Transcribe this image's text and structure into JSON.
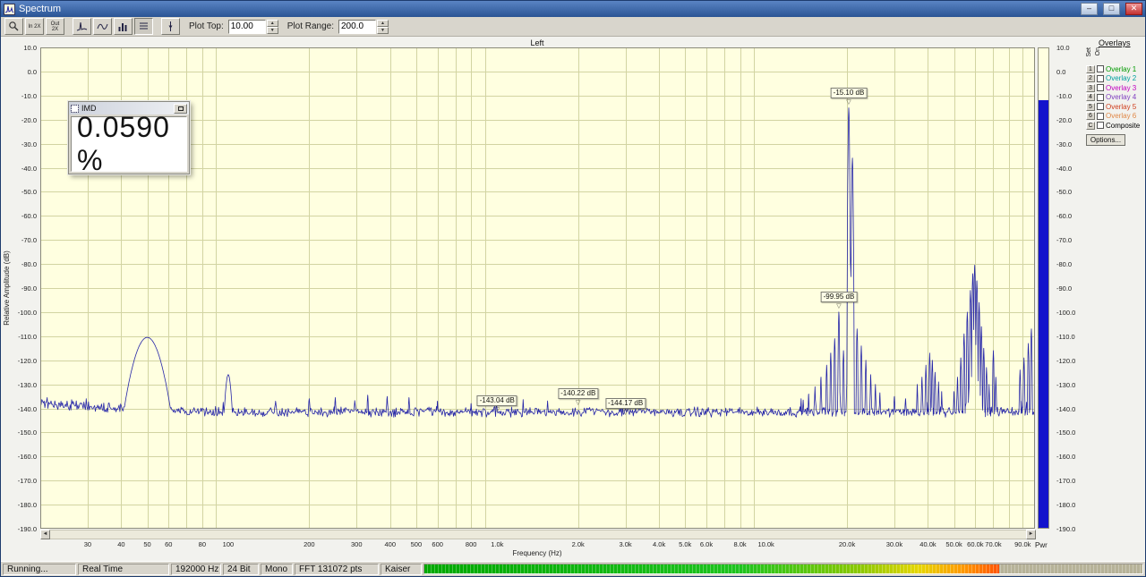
{
  "window": {
    "title": "Spectrum",
    "controls": {
      "minimize_glyph": "–",
      "maximize_glyph": "□",
      "close_glyph": "✕"
    }
  },
  "toolbar": {
    "zoom_in_2x": "In 2X",
    "zoom_out_2x": "Out 2X",
    "plot_top_label": "Plot Top:",
    "plot_top_value": "10.00",
    "plot_range_label": "Plot Range:",
    "plot_range_value": "200.0",
    "spin_up_glyph": "▲",
    "spin_down_glyph": "▼"
  },
  "plot": {
    "channel_label": "Left",
    "y_axis_title": "Relative Amplitude (dB)",
    "x_axis_title": "Frequency (Hz)"
  },
  "scrollbar": {
    "left_glyph": "◄",
    "right_glyph": "►"
  },
  "meter": {
    "value_db": -12.2,
    "label": "Pwr"
  },
  "imd": {
    "title": "IMD",
    "value": "0.0590 %"
  },
  "overlays": {
    "title": "Overlays",
    "col_set": "Set",
    "col_on": "On",
    "items": [
      {
        "num": "1",
        "label": "Overlay 1",
        "color": "#009900",
        "checked": false
      },
      {
        "num": "2",
        "label": "Overlay 2",
        "color": "#00a0a0",
        "checked": false
      },
      {
        "num": "3",
        "label": "Overlay 3",
        "color": "#c000c0",
        "checked": false
      },
      {
        "num": "4",
        "label": "Overlay 4",
        "color": "#8040c0",
        "checked": false
      },
      {
        "num": "5",
        "label": "Overlay 5",
        "color": "#d04020",
        "checked": false
      },
      {
        "num": "6",
        "label": "Overlay 6",
        "color": "#e08848",
        "checked": false
      },
      {
        "num": "C",
        "label": "Composite",
        "color": "#000000",
        "checked": false
      }
    ],
    "options_label": "Options..."
  },
  "status_bar": {
    "segments": [
      "Running...",
      "Real Time",
      "192000 Hz",
      "24 Bit",
      "Mono",
      "FFT 131072 pts",
      "Kaiser"
    ],
    "progress_fraction": 0.8
  },
  "chart_data": {
    "type": "line",
    "title": "Real-time FFT spectrum, Left channel, IMD test",
    "xlabel": "Frequency (Hz)",
    "ylabel": "Relative Amplitude (dB)",
    "x_scale": "log",
    "x_range_hz": [
      20,
      100000
    ],
    "y_range_db": [
      -190,
      10
    ],
    "grid": true,
    "plot_bg": "#ffffe0",
    "grid_color": "#d2d4a2",
    "trace_color": "#2626a8",
    "noise_floor_db": -141.5,
    "y_ticks": [
      "10.0",
      "0.0",
      "-10.0",
      "-20.0",
      "-30.0",
      "-40.0",
      "-50.0",
      "-60.0",
      "-70.0",
      "-80.0",
      "-90.0",
      "-100.0",
      "-110.0",
      "-120.0",
      "-130.0",
      "-140.0",
      "-150.0",
      "-160.0",
      "-170.0",
      "-180.0",
      "-190.0"
    ],
    "x_ticks": [
      {
        "f": 30,
        "t": "30"
      },
      {
        "f": 40,
        "t": "40"
      },
      {
        "f": 50,
        "t": "50"
      },
      {
        "f": 60,
        "t": "60"
      },
      {
        "f": 80,
        "t": "80"
      },
      {
        "f": 100,
        "t": "100"
      },
      {
        "f": 200,
        "t": "200"
      },
      {
        "f": 300,
        "t": "300"
      },
      {
        "f": 400,
        "t": "400"
      },
      {
        "f": 500,
        "t": "500"
      },
      {
        "f": 600,
        "t": "600"
      },
      {
        "f": 800,
        "t": "800"
      },
      {
        "f": 1000,
        "t": "1.0k"
      },
      {
        "f": 2000,
        "t": "2.0k"
      },
      {
        "f": 3000,
        "t": "3.0k"
      },
      {
        "f": 4000,
        "t": "4.0k"
      },
      {
        "f": 5000,
        "t": "5.0k"
      },
      {
        "f": 6000,
        "t": "6.0k"
      },
      {
        "f": 8000,
        "t": "8.0k"
      },
      {
        "f": 10000,
        "t": "10.0k"
      },
      {
        "f": 20000,
        "t": "20.0k"
      },
      {
        "f": 30000,
        "t": "30.0k"
      },
      {
        "f": 40000,
        "t": "40.0k"
      },
      {
        "f": 50000,
        "t": "50.0k"
      },
      {
        "f": 60000,
        "t": "60.0k"
      },
      {
        "f": 70000,
        "t": "70.0k"
      },
      {
        "f": 90000,
        "t": "90.0k"
      }
    ],
    "markers": [
      {
        "text": "-15.10 dB",
        "f": 20300,
        "db": -15.1
      },
      {
        "text": "-99.95 dB",
        "f": 18650,
        "db": -99.95
      },
      {
        "text": "-143.04 dB",
        "f": 1000,
        "db": -143.04
      },
      {
        "text": "-140.22 dB",
        "f": 2000,
        "db": -140.22
      },
      {
        "text": "-144.17 dB",
        "f": 3000,
        "db": -144.17
      }
    ],
    "peaks": [
      {
        "f": 50,
        "db": -110.5,
        "s": 0.05
      },
      {
        "f": 100,
        "db": -126,
        "s": 0.012
      },
      {
        "f": 150,
        "db": -137,
        "s": 0.004
      },
      {
        "f": 200,
        "db": -136,
        "s": 0.004
      },
      {
        "f": 250,
        "db": -135.5,
        "s": 0.003
      },
      {
        "f": 330,
        "db": -134.5,
        "s": 0.003
      },
      {
        "f": 390,
        "db": -135,
        "s": 0.003
      },
      {
        "f": 470,
        "db": -135.5,
        "s": 0.003
      },
      {
        "f": 600,
        "db": -137,
        "s": 0.003
      },
      {
        "f": 800,
        "db": -138,
        "s": 0.003
      },
      {
        "f": 13500,
        "db": -136
      },
      {
        "f": 14400,
        "db": -134
      },
      {
        "f": 15200,
        "db": -131
      },
      {
        "f": 16000,
        "db": -127
      },
      {
        "f": 16800,
        "db": -122
      },
      {
        "f": 17400,
        "db": -117
      },
      {
        "f": 18000,
        "db": -111
      },
      {
        "f": 18650,
        "db": -99.95
      },
      {
        "f": 19400,
        "db": -116
      },
      {
        "f": 20300,
        "db": -15.1
      },
      {
        "f": 20600,
        "db": -80
      },
      {
        "f": 20950,
        "db": -36
      },
      {
        "f": 21800,
        "db": -107
      },
      {
        "f": 22600,
        "db": -114
      },
      {
        "f": 23500,
        "db": -120
      },
      {
        "f": 24500,
        "db": -126
      },
      {
        "f": 25500,
        "db": -130
      },
      {
        "f": 26500,
        "db": -133.5
      },
      {
        "f": 30000,
        "db": -135,
        "s": 0.003
      },
      {
        "f": 33000,
        "db": -136,
        "s": 0.003
      },
      {
        "f": 36500,
        "db": -130
      },
      {
        "f": 38000,
        "db": -127
      },
      {
        "f": 39300,
        "db": -122
      },
      {
        "f": 40600,
        "db": -117
      },
      {
        "f": 41500,
        "db": -120
      },
      {
        "f": 42500,
        "db": -125
      },
      {
        "f": 43800,
        "db": -129
      },
      {
        "f": 45000,
        "db": -133
      },
      {
        "f": 50000,
        "db": -133
      },
      {
        "f": 51500,
        "db": -127
      },
      {
        "f": 53000,
        "db": -119
      },
      {
        "f": 54500,
        "db": -109
      },
      {
        "f": 56000,
        "db": -100
      },
      {
        "f": 57500,
        "db": -91
      },
      {
        "f": 58700,
        "db": -84
      },
      {
        "f": 59700,
        "db": -80.5
      },
      {
        "f": 60800,
        "db": -87
      },
      {
        "f": 62000,
        "db": -96
      },
      {
        "f": 63200,
        "db": -106
      },
      {
        "f": 64500,
        "db": -115
      },
      {
        "f": 66000,
        "db": -123
      },
      {
        "f": 67500,
        "db": -130
      },
      {
        "f": 70000,
        "db": -116
      },
      {
        "f": 71500,
        "db": -127
      },
      {
        "f": 88000,
        "db": -124
      },
      {
        "f": 91000,
        "db": -119
      },
      {
        "f": 94500,
        "db": -113
      },
      {
        "f": 97000,
        "db": -107
      }
    ]
  }
}
